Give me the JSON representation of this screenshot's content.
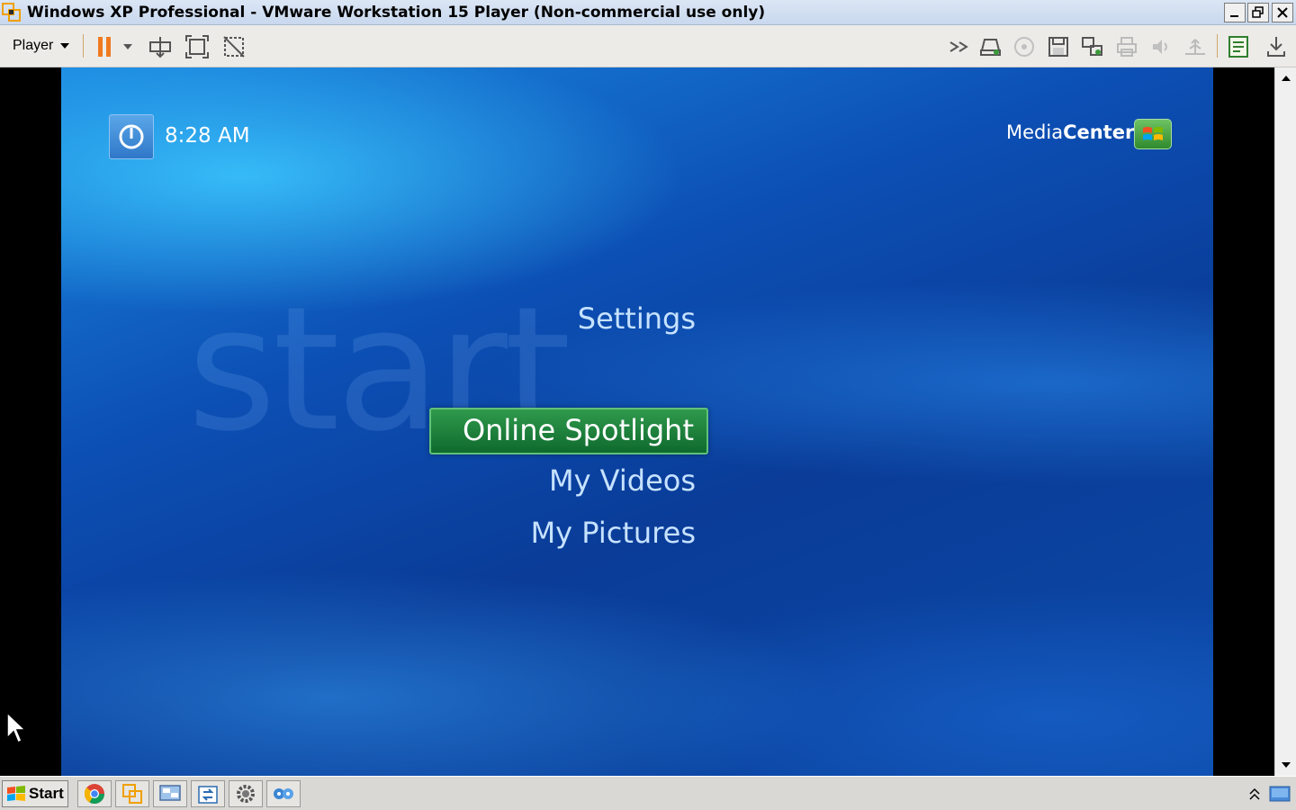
{
  "window": {
    "title": "Windows XP Professional - VMware Workstation 15 Player (Non-commercial use only)"
  },
  "toolbar": {
    "player_menu_label": "Player",
    "icons_left": [
      "pause-icon",
      "pause-dropdown-icon",
      "send-ctrl-alt-del-icon",
      "fit-guest-icon",
      "unity-icon"
    ],
    "icons_right": [
      "more-devices-icon",
      "network-adapter-icon",
      "cd-dvd-icon",
      "floppy-icon",
      "usb-device-icon",
      "printer-icon",
      "sound-card-icon",
      "usb-controller-icon",
      "message-log-icon",
      "download-icon"
    ]
  },
  "media_center": {
    "clock": "8:28 AM",
    "logo_regular": "Media",
    "logo_bold": "Center",
    "watermark": "start",
    "menu": {
      "settings": "Settings",
      "selected": "Online Spotlight",
      "videos": "My Videos",
      "pictures": "My Pictures"
    },
    "colors": {
      "selected_bg": "#1f7f3c",
      "menu_text": "#c6e2ff",
      "background": "#0c4fb4"
    }
  },
  "taskbar": {
    "start_label": "Start",
    "apps": [
      "chrome-icon",
      "vmware-icon",
      "network-icon",
      "sync-icon",
      "settings-gear-icon",
      "messenger-icon"
    ]
  }
}
